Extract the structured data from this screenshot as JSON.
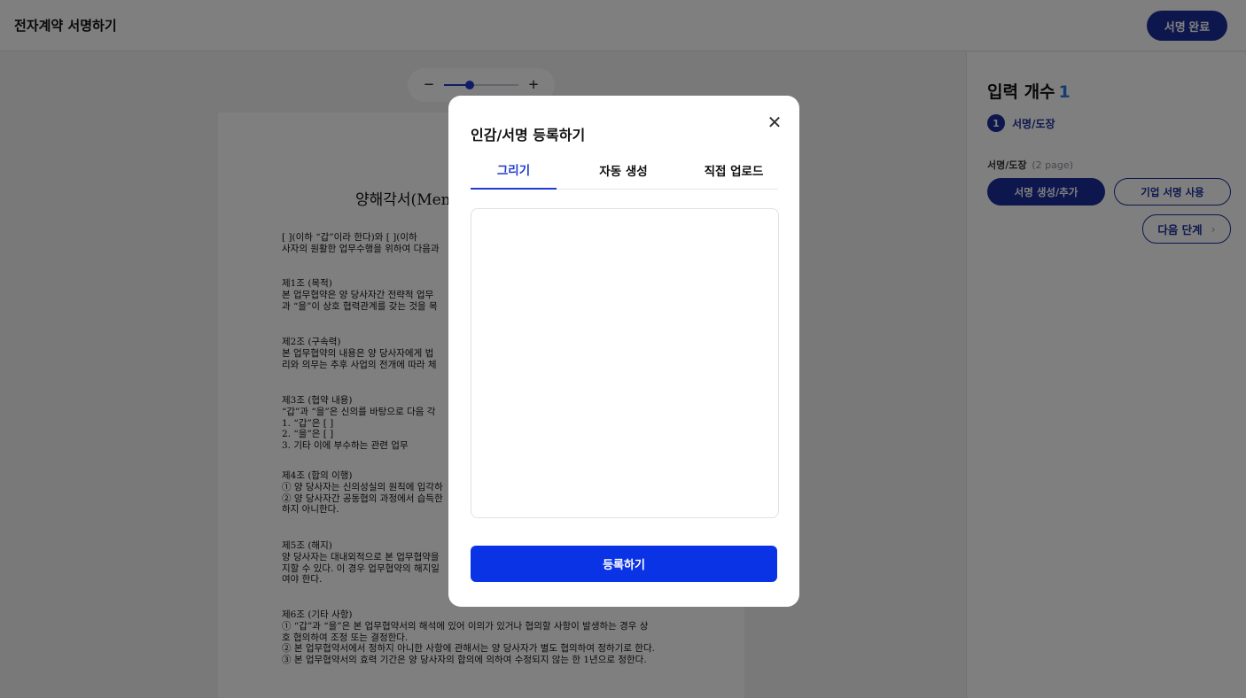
{
  "header": {
    "title": "전자계약 서명하기",
    "done_label": "서명 완료"
  },
  "zoom": {
    "minus_icon": "−",
    "plus_icon": "+",
    "level": 0.34
  },
  "document": {
    "title": "양해각서(Memo",
    "blocks": [
      [
        "[        ](이하  “갑”이라  한다)와  [      ](이하",
        "사자의  원활한  업무수행을  위하여  다음과"
      ],
      [
        "제1조  (목적)",
        "본  업무협약은  양  당사자간  전략적  업무",
        "과  “을”이  상호  협력관계를  갖는  것을  목"
      ],
      [
        "제2조  (구속력)",
        "본  업무협약의  내용은  양  당사자에게  법",
        "리와  의무는  추후  사업의  전개에  따라  체"
      ],
      [
        "제3조  (협약  내용)",
        "“갑”과  “을”은  신의를  바탕으로  다음  각",
        "1.     “갑”은  [                    ]",
        "2.     “을”은  [                    ]",
        "3.     기타  이에  부수하는  관련  업무"
      ],
      [
        "제4조  (합의  이행)",
        "①  양  당사자는  신의성실의  원칙에  입각하",
        "②  양  당사자간  공동협의  과정에서  습득한",
        "하지  아니한다."
      ],
      [
        "제5조  (해지)",
        "양  당사자는  대내외적으로  본  업무협약을",
        "지할  수  있다.  이  경우  업무협약의  해지일",
        "여야  한다."
      ],
      [
        "제6조  (기타  사항)",
        "①   “갑”과  “을”은  본  업무협약서의  해석에  있어  이의가  있거나  협의할  사항이  발생하는  경우  상",
        "호  협의하여  조정  또는  결정한다.",
        "②  본  업무협약서에서  정하지  아니한  사항에  관해서는  양  당사자가  별도  협의하여  정하기로  한다.",
        "③  본  업무협약서의  효력  기간은  양  당사자의  합의에  의하여  수정되지  않는  한  1년으로  정한다."
      ]
    ]
  },
  "side": {
    "count_label": "입력 개수",
    "count_value": "1",
    "step_number": "1",
    "step_label": "서명/도장",
    "field_label": "서명/도장",
    "field_page": "(2 page)",
    "create_label": "서명 생성/추가",
    "corp_label": "기업 서명 사용",
    "next_label": "다음 단계",
    "next_icon": "›"
  },
  "modal": {
    "title": "인감/서명 등록하기",
    "close_icon": "✕",
    "tabs": [
      "그리기",
      "자동 생성",
      "직접 업로드"
    ],
    "active_tab": 0,
    "submit_label": "등록하기"
  }
}
